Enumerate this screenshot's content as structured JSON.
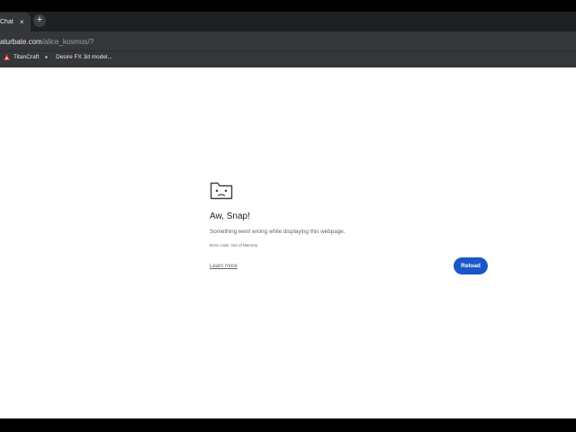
{
  "browser": {
    "tab": {
      "title": "Chat",
      "close": "×"
    },
    "new_tab": "+",
    "address": {
      "host": "aturbate.com",
      "path": "/alice_kosmos/?"
    },
    "bookmarks": [
      {
        "label": "TitanCraft",
        "icon": "titancraft-icon"
      },
      {
        "label": "Desire FX 3d model...",
        "icon": "bookmark-dot-icon"
      }
    ]
  },
  "error_page": {
    "title": "Aw, Snap!",
    "message": "Something went wrong while displaying this webpage.",
    "error_code": "Error code: Out of Memory",
    "learn_more": "Learn more",
    "reload": "Reload",
    "icon": "sad-folder-icon",
    "accent_color": "#1a56c8"
  }
}
